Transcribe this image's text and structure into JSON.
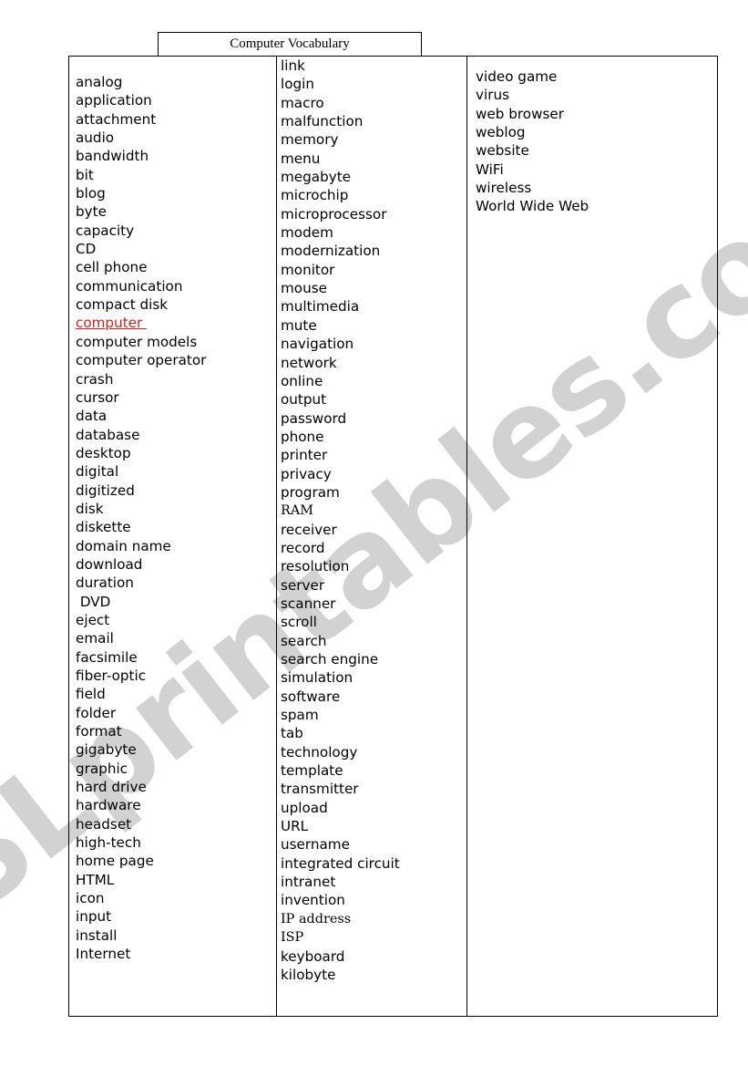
{
  "document": {
    "title": "Computer Vocabulary",
    "watermark": "ESLprintables.com",
    "link_color": "#cc2222",
    "text_color": "#000000",
    "border_color": "#000000",
    "watermark_color": "#d2d2d2"
  },
  "columns": [
    {
      "id": "column-1",
      "words": [
        {
          "text": "analog",
          "style": "normal"
        },
        {
          "text": "application",
          "style": "normal"
        },
        {
          "text": "attachment",
          "style": "normal"
        },
        {
          "text": "audio",
          "style": "normal"
        },
        {
          "text": "bandwidth",
          "style": "normal"
        },
        {
          "text": "bit",
          "style": "normal"
        },
        {
          "text": "blog",
          "style": "normal"
        },
        {
          "text": "byte",
          "style": "normal"
        },
        {
          "text": "capacity",
          "style": "normal"
        },
        {
          "text": "CD",
          "style": "normal"
        },
        {
          "text": "cell phone",
          "style": "normal"
        },
        {
          "text": "communication",
          "style": "normal"
        },
        {
          "text": "compact disk",
          "style": "normal"
        },
        {
          "text": "computer ",
          "style": "link"
        },
        {
          "text": "computer models",
          "style": "normal"
        },
        {
          "text": "computer operator",
          "style": "normal"
        },
        {
          "text": "crash",
          "style": "normal"
        },
        {
          "text": "cursor",
          "style": "normal"
        },
        {
          "text": "data",
          "style": "normal"
        },
        {
          "text": "database",
          "style": "normal"
        },
        {
          "text": "desktop",
          "style": "normal"
        },
        {
          "text": "digital",
          "style": "normal"
        },
        {
          "text": "digitized",
          "style": "normal"
        },
        {
          "text": "disk",
          "style": "normal"
        },
        {
          "text": "diskette",
          "style": "normal"
        },
        {
          "text": "domain name",
          "style": "normal"
        },
        {
          "text": "download",
          "style": "normal"
        },
        {
          "text": "duration",
          "style": "normal"
        },
        {
          "text": " DVD",
          "style": "normal"
        },
        {
          "text": "eject",
          "style": "normal"
        },
        {
          "text": "email",
          "style": "normal"
        },
        {
          "text": "facsimile",
          "style": "normal"
        },
        {
          "text": "fiber-optic",
          "style": "normal"
        },
        {
          "text": "field",
          "style": "normal"
        },
        {
          "text": "folder",
          "style": "normal"
        },
        {
          "text": "format",
          "style": "normal"
        },
        {
          "text": "gigabyte",
          "style": "normal"
        },
        {
          "text": "graphic",
          "style": "normal"
        },
        {
          "text": "hard drive",
          "style": "normal"
        },
        {
          "text": "hardware",
          "style": "normal"
        },
        {
          "text": "headset",
          "style": "normal"
        },
        {
          "text": "high-tech",
          "style": "normal"
        },
        {
          "text": "home page",
          "style": "normal"
        },
        {
          "text": "HTML",
          "style": "normal"
        },
        {
          "text": "icon",
          "style": "normal"
        },
        {
          "text": "input",
          "style": "normal"
        },
        {
          "text": "install",
          "style": "normal"
        },
        {
          "text": "Internet",
          "style": "normal"
        }
      ]
    },
    {
      "id": "column-2",
      "words": [
        {
          "text": "link",
          "style": "normal"
        },
        {
          "text": "login",
          "style": "normal"
        },
        {
          "text": "macro",
          "style": "normal"
        },
        {
          "text": "malfunction",
          "style": "normal"
        },
        {
          "text": "memory",
          "style": "normal"
        },
        {
          "text": "menu",
          "style": "normal"
        },
        {
          "text": "megabyte",
          "style": "normal"
        },
        {
          "text": "microchip",
          "style": "normal"
        },
        {
          "text": "microprocessor",
          "style": "normal"
        },
        {
          "text": "modem",
          "style": "normal"
        },
        {
          "text": "modernization",
          "style": "normal"
        },
        {
          "text": "monitor",
          "style": "normal"
        },
        {
          "text": "mouse",
          "style": "normal"
        },
        {
          "text": "multimedia",
          "style": "normal"
        },
        {
          "text": "mute",
          "style": "normal"
        },
        {
          "text": "navigation",
          "style": "normal"
        },
        {
          "text": "network",
          "style": "normal"
        },
        {
          "text": "online",
          "style": "normal"
        },
        {
          "text": "output",
          "style": "normal"
        },
        {
          "text": "password",
          "style": "normal"
        },
        {
          "text": "phone",
          "style": "normal"
        },
        {
          "text": "printer",
          "style": "normal"
        },
        {
          "text": "privacy",
          "style": "normal"
        },
        {
          "text": "program",
          "style": "normal"
        },
        {
          "text": "RAM",
          "style": "serifish"
        },
        {
          "text": "receiver",
          "style": "normal"
        },
        {
          "text": "record",
          "style": "normal"
        },
        {
          "text": "resolution",
          "style": "normal"
        },
        {
          "text": "server",
          "style": "normal"
        },
        {
          "text": "scanner",
          "style": "normal"
        },
        {
          "text": "scroll",
          "style": "normal"
        },
        {
          "text": "search",
          "style": "normal"
        },
        {
          "text": "search engine",
          "style": "normal"
        },
        {
          "text": "simulation",
          "style": "normal"
        },
        {
          "text": "software",
          "style": "normal"
        },
        {
          "text": "spam",
          "style": "normal"
        },
        {
          "text": "tab",
          "style": "normal"
        },
        {
          "text": "technology",
          "style": "normal"
        },
        {
          "text": "template",
          "style": "normal"
        },
        {
          "text": "transmitter",
          "style": "normal"
        },
        {
          "text": "upload",
          "style": "normal"
        },
        {
          "text": "URL",
          "style": "normal"
        },
        {
          "text": "username",
          "style": "normal"
        },
        {
          "text": "integrated circuit",
          "style": "normal"
        },
        {
          "text": "intranet",
          "style": "normal"
        },
        {
          "text": "invention",
          "style": "normal"
        },
        {
          "text": "IP address",
          "style": "serifish"
        },
        {
          "text": "ISP",
          "style": "serifish"
        },
        {
          "text": "keyboard",
          "style": "normal"
        },
        {
          "text": "kilobyte",
          "style": "normal"
        }
      ]
    },
    {
      "id": "column-3",
      "words": [
        {
          "text": "video game",
          "style": "normal"
        },
        {
          "text": "virus",
          "style": "normal"
        },
        {
          "text": "web browser",
          "style": "normal"
        },
        {
          "text": "weblog",
          "style": "normal"
        },
        {
          "text": "website",
          "style": "normal"
        },
        {
          "text": "WiFi",
          "style": "normal"
        },
        {
          "text": "wireless",
          "style": "normal"
        },
        {
          "text": "World Wide Web",
          "style": "normal"
        }
      ]
    }
  ]
}
